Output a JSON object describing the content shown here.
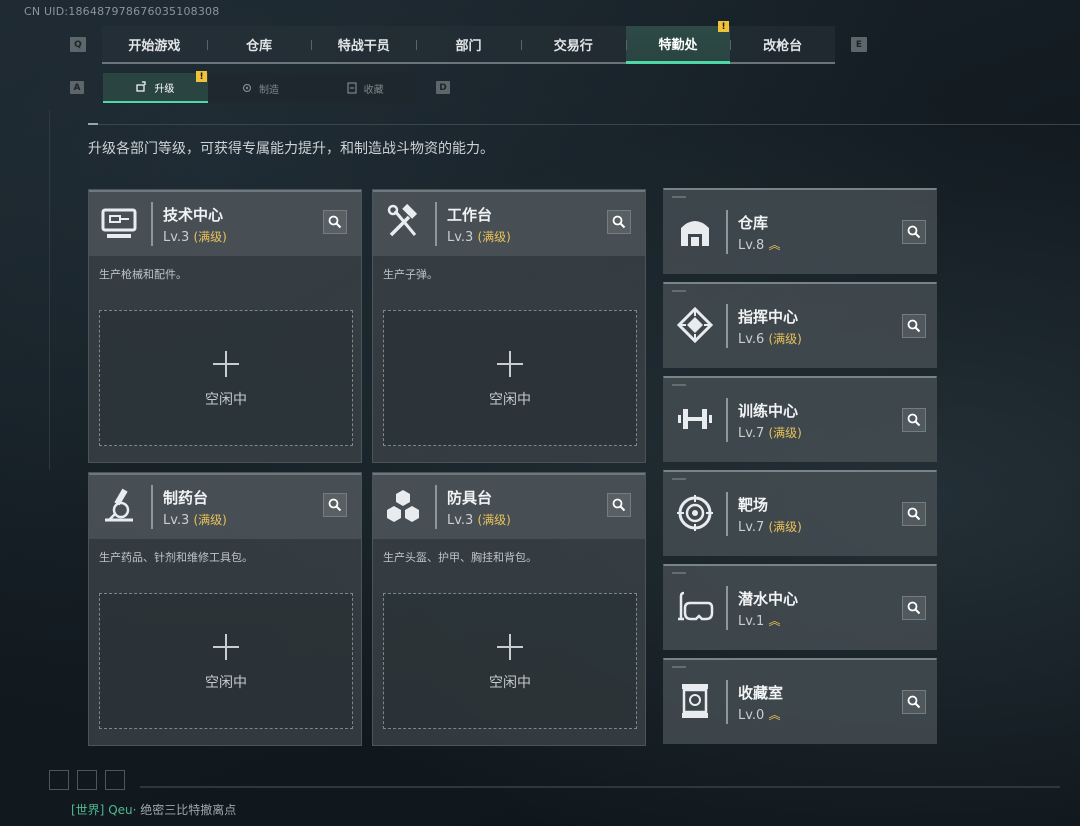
{
  "uid": "CN UID:186487978676035108308",
  "nav": {
    "prev_key": "Q",
    "next_key": "E",
    "tabs": [
      "开始游戏",
      "仓库",
      "特战干员",
      "部门",
      "交易行",
      "特勤处",
      "改枪台"
    ],
    "active_tab": "特勤处",
    "alert": "!"
  },
  "subnav": {
    "prev_key": "A",
    "next_key": "D",
    "tabs": [
      {
        "label": "升级",
        "icon": "upgrade-icon",
        "active": true
      },
      {
        "label": "制造",
        "icon": "gear-icon",
        "active": false
      },
      {
        "label": "收藏",
        "icon": "collection-icon",
        "active": false
      }
    ],
    "alert": "!"
  },
  "description": "升级各部门等级，可获得专属能力提升，和制造战斗物资的能力。",
  "workbenches": [
    {
      "name": "技术中心",
      "level": "Lv.3",
      "status": "(满级)",
      "desc": "生产枪械和配件。",
      "slot": "空闲中",
      "icon": "computer-icon"
    },
    {
      "name": "工作台",
      "level": "Lv.3",
      "status": "(满级)",
      "desc": "生产子弹。",
      "slot": "空闲中",
      "icon": "hammer-wrench-icon"
    },
    {
      "name": "制药台",
      "level": "Lv.3",
      "status": "(满级)",
      "desc": "生产药品、针剂和维修工具包。",
      "slot": "空闲中",
      "icon": "microscope-icon"
    },
    {
      "name": "防具台",
      "level": "Lv.3",
      "status": "(满级)",
      "desc": "生产头盔、护甲、胸挂和背包。",
      "slot": "空闲中",
      "icon": "cubes-icon"
    }
  ],
  "departments": [
    {
      "name": "仓库",
      "level": "Lv.8",
      "status": "",
      "upgradable": true,
      "icon": "warehouse-icon"
    },
    {
      "name": "指挥中心",
      "level": "Lv.6",
      "status": "(满级)",
      "upgradable": false,
      "icon": "command-icon"
    },
    {
      "name": "训练中心",
      "level": "Lv.7",
      "status": "(满级)",
      "upgradable": false,
      "icon": "dumbbell-icon"
    },
    {
      "name": "靶场",
      "level": "Lv.7",
      "status": "(满级)",
      "upgradable": false,
      "icon": "target-icon"
    },
    {
      "name": "潜水中心",
      "level": "Lv.1",
      "status": "",
      "upgradable": true,
      "icon": "diving-mask-icon"
    },
    {
      "name": "收藏室",
      "level": "Lv.0",
      "status": "",
      "upgradable": true,
      "icon": "trophy-case-icon"
    }
  ],
  "chat": {
    "channel": "[世界]",
    "name": "Qeu·",
    "message": "绝密三比特撤离点"
  },
  "colors": {
    "accent": "#4fd7a6",
    "max_level": "#e8c25a",
    "alert": "#f0c23a"
  }
}
